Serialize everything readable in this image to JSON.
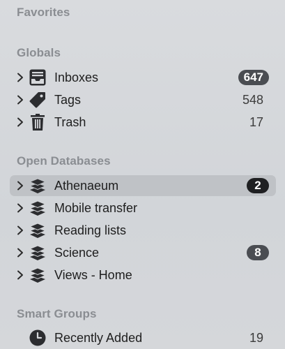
{
  "sections": {
    "favorites": "Favorites",
    "globals": "Globals",
    "open_databases": "Open Databases",
    "smart_groups": "Smart Groups"
  },
  "globals": [
    {
      "label": "Inboxes",
      "count": "647",
      "badge": true,
      "icon": "inbox-icon"
    },
    {
      "label": "Tags",
      "count": "548",
      "badge": false,
      "icon": "tag-icon"
    },
    {
      "label": "Trash",
      "count": "17",
      "badge": false,
      "icon": "trash-icon"
    }
  ],
  "databases": [
    {
      "label": "Athenaeum",
      "count": "2",
      "badge": true,
      "selected": true,
      "icon": "database-stack-icon"
    },
    {
      "label": "Mobile transfer",
      "count": "",
      "badge": false,
      "icon": "database-stack-icon"
    },
    {
      "label": "Reading lists",
      "count": "",
      "badge": false,
      "icon": "database-stack-icon"
    },
    {
      "label": "Science",
      "count": "8",
      "badge": true,
      "icon": "database-stack-icon"
    },
    {
      "label": "Views - Home",
      "count": "",
      "badge": false,
      "icon": "database-stack-icon"
    }
  ],
  "smart_groups": [
    {
      "label": "Recently Added",
      "count": "19",
      "badge": false,
      "icon": "clock-icon"
    }
  ],
  "colors": {
    "badge_grey": "#4a4d52",
    "badge_dark": "#1f2022",
    "selection": "#bfc2c6",
    "header_text": "#8a8d92"
  }
}
